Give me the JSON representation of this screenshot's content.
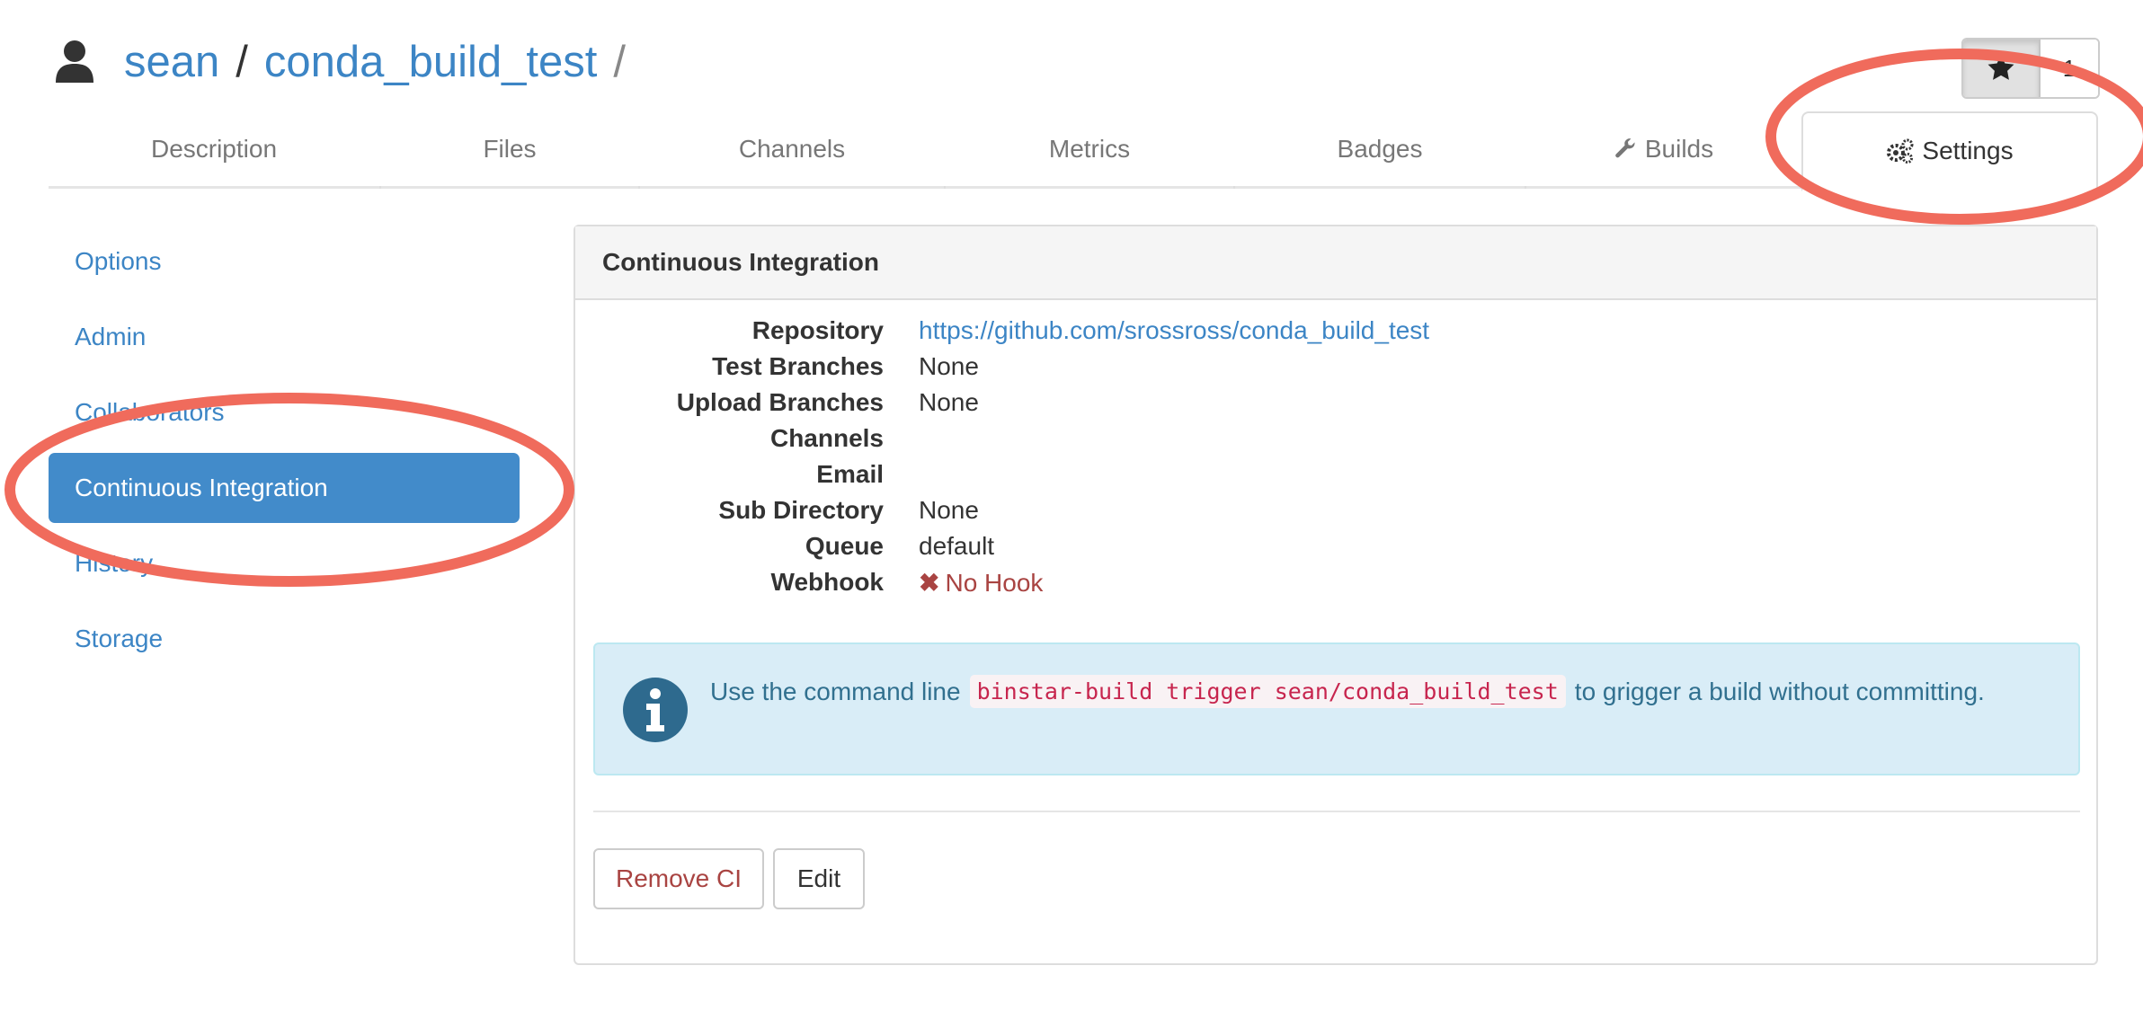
{
  "header": {
    "user": "sean",
    "separator": "/",
    "repo": "conda_build_test",
    "trailing_separator": "/",
    "star_count": "1"
  },
  "tabs": [
    {
      "label": "Description"
    },
    {
      "label": "Files"
    },
    {
      "label": "Channels"
    },
    {
      "label": "Metrics"
    },
    {
      "label": "Badges"
    },
    {
      "label": "Builds"
    },
    {
      "label": "Settings"
    }
  ],
  "sidebar": {
    "items": [
      {
        "label": "Options"
      },
      {
        "label": "Admin"
      },
      {
        "label": "Collaborators"
      },
      {
        "label": "Continuous Integration"
      },
      {
        "label": "History"
      },
      {
        "label": "Storage"
      }
    ],
    "active_index": 3
  },
  "panel": {
    "title": "Continuous Integration",
    "properties": [
      {
        "key": "Repository",
        "value": "https://github.com/srossross/conda_build_test"
      },
      {
        "key": "Test Branches",
        "value": "None"
      },
      {
        "key": "Upload Branches",
        "value": "None"
      },
      {
        "key": "Channels",
        "value": ""
      },
      {
        "key": "Email",
        "value": ""
      },
      {
        "key": "Sub Directory",
        "value": "None"
      },
      {
        "key": "Queue",
        "value": "default"
      },
      {
        "key": "Webhook",
        "value": "No Hook"
      }
    ],
    "alert": {
      "prefix": "Use the command line",
      "command": "binstar-build trigger sean/conda_build_test",
      "suffix": "to grigger a build without committing."
    },
    "buttons": {
      "remove": "Remove CI",
      "edit": "Edit"
    }
  },
  "colors": {
    "link": "#3c85c5",
    "active_nav": "#428bca",
    "danger": "#a94442",
    "annotation": "#f06b5c"
  }
}
